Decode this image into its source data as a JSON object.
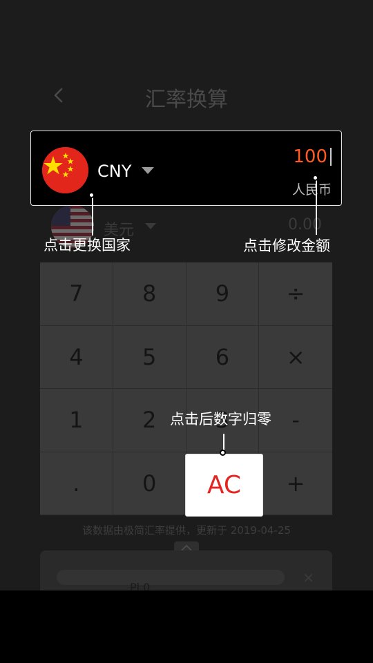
{
  "header": {
    "title": "汇率换算"
  },
  "source_currency": {
    "code": "CNY",
    "amount": "100",
    "name": "人民币"
  },
  "target_currency": {
    "name": "美元",
    "amount": "0.00"
  },
  "keypad": {
    "keys": [
      "7",
      "8",
      "9",
      "÷",
      "4",
      "5",
      "6",
      "×",
      "1",
      "2",
      "3",
      "-",
      ".",
      "0",
      "AC",
      "+"
    ]
  },
  "footer": {
    "source_text": "该数据由极简汇率提供，更新于 2019-04-25",
    "sheet_text": "Pl 0"
  },
  "guide": {
    "change_country": "点击更换国家",
    "edit_amount": "点击修改金额",
    "reset_hint": "点击后数字归零"
  },
  "colors": {
    "amount": "#ff5a1f",
    "ac_text": "#e52521",
    "flag_red": "#e3261c",
    "flag_star": "#ffde00"
  }
}
